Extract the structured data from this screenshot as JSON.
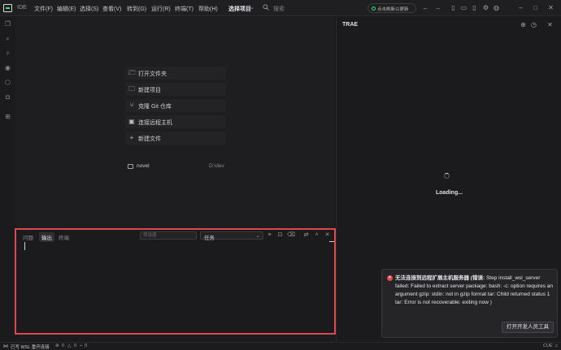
{
  "titlebar": {
    "ide_tag": "IDE",
    "menus": [
      "文件(F)",
      "编辑(E)",
      "选择(S)",
      "查看(V)",
      "转到(G)",
      "运行(R)",
      "终端(T)",
      "帮助(H)"
    ],
    "project_label": "选择项目",
    "search_placeholder": "搜索",
    "update_label": "点击刷新以更新"
  },
  "welcome": {
    "items": [
      "打开文件夹",
      "新建项目",
      "克隆 Git 仓库",
      "连接远程主机",
      "新建文件"
    ],
    "recent": [
      {
        "name": "novel",
        "path": "D:\\dev"
      }
    ]
  },
  "right_panel": {
    "title": "TRAE",
    "loading": "Loading..."
  },
  "bottom_panel": {
    "tabs": [
      "问题",
      "输出",
      "终端"
    ],
    "active_tab": "输出",
    "filter_placeholder": "筛选器",
    "task_select": "任务"
  },
  "notification": {
    "title": "无法连接到远程扩展主机服务器 (错误:",
    "body": "Step install_wsl_server failed: Failed to extract server package: bash: -c: option requires an argument gzip: stdin: not in gzip format tar: Child returned status 1 tar: Error is not recoverable: exiting now )",
    "button": "打开开发人员工具"
  },
  "statusbar": {
    "remote": "已写 WSL 重开连接",
    "errors": "0",
    "warnings": "0",
    "ports": "0",
    "right": "CUE"
  },
  "colors": {
    "accent_green": "#3ee07a",
    "error_red": "#e0484c",
    "highlight_border": "#e0484c"
  }
}
